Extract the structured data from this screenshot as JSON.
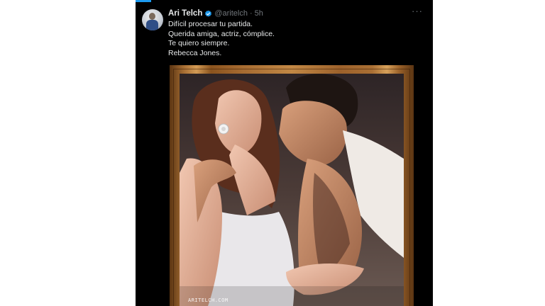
{
  "tweet": {
    "author": {
      "display_name": "Ari Telch",
      "handle": "@aritelch",
      "verified": true
    },
    "separator": "·",
    "time": "5h",
    "text_lines": [
      "Difícil procesar tu partida.",
      "Querida amiga, actriz, cómplice.",
      "Te quiero siempre.",
      "Rebecca Jones."
    ],
    "more_icon": "more-horizontal-icon",
    "image": {
      "watermark": "ARITELCH.COM"
    }
  },
  "colors": {
    "panel_background": "#000000",
    "text_primary": "#e7e9ea",
    "text_secondary": "#71767b",
    "verified_badge": "#1d9bf0",
    "frame_gold": "#c28845"
  }
}
